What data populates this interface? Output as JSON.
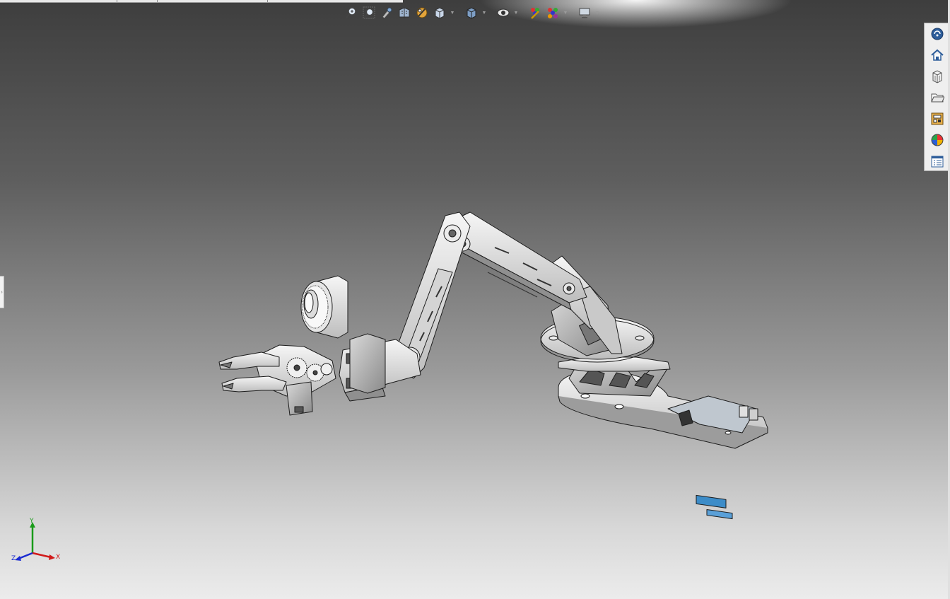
{
  "viewport": {
    "background_top": "#3e3e3e",
    "background_bottom": "#ececec"
  },
  "hud_toolbar": {
    "buttons": [
      {
        "icon": "zoom-to-fit-icon"
      },
      {
        "icon": "zoom-to-area-icon"
      },
      {
        "icon": "previous-view-icon"
      },
      {
        "icon": "section-view-icon"
      },
      {
        "icon": "dynamic-annotation-views-icon"
      },
      {
        "icon": "view-orientation-icon",
        "dropdown": true
      },
      {
        "icon": "display-style-icon",
        "dropdown": true
      },
      {
        "icon": "hide-show-items-icon",
        "dropdown": true
      },
      {
        "icon": "edit-appearance-icon"
      },
      {
        "icon": "apply-scene-icon",
        "dropdown": true
      },
      {
        "icon": "view-settings-icon",
        "dropdown": true
      }
    ]
  },
  "task_pane": {
    "tabs": [
      {
        "icon": "solidworks-resources-icon"
      },
      {
        "icon": "home-icon"
      },
      {
        "icon": "design-library-icon"
      },
      {
        "icon": "file-explorer-icon"
      },
      {
        "icon": "view-palette-icon"
      },
      {
        "icon": "appearances-scenes-icon"
      },
      {
        "icon": "custom-properties-icon"
      }
    ]
  },
  "triad": {
    "x_label": "X",
    "y_label": "Y",
    "z_label": "Z",
    "x_color": "#d11a1a",
    "y_color": "#1a9b1a",
    "z_color": "#1a2bd1"
  }
}
